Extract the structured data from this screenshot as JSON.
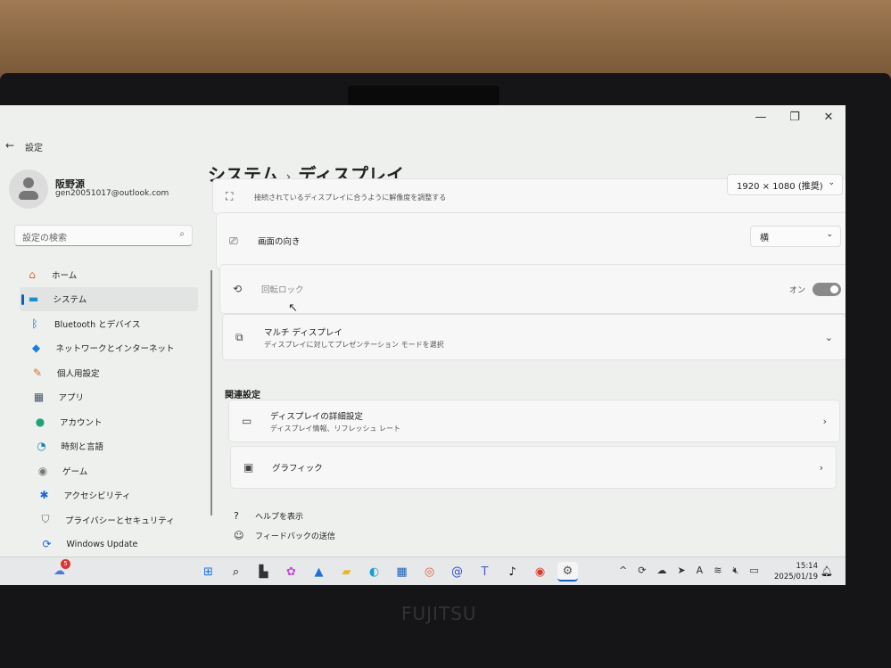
{
  "window": {
    "title": "設定",
    "controls": [
      "—",
      "❐",
      "✕"
    ]
  },
  "user": {
    "name": "阪野源",
    "email": "gen20051017@outlook.com"
  },
  "search": {
    "placeholder": "設定の検索"
  },
  "sidebar": {
    "items": [
      {
        "label": "ホーム",
        "icon": "home-icon",
        "glyph": "⌂",
        "color": "#d9663b"
      },
      {
        "label": "システム",
        "icon": "system-icon",
        "glyph": "▬",
        "color": "#1a8fd0",
        "selected": true
      },
      {
        "label": "Bluetooth とデバイス",
        "icon": "bluetooth-icon",
        "glyph": "ᛒ",
        "color": "#1565d8"
      },
      {
        "label": "ネットワークとインターネット",
        "icon": "wifi-icon",
        "glyph": "◆",
        "color": "#1a7fd8"
      },
      {
        "label": "個人用設定",
        "icon": "brush-icon",
        "glyph": "✎",
        "color": "#d0702a"
      },
      {
        "label": "アプリ",
        "icon": "apps-icon",
        "glyph": "▦",
        "color": "#445566"
      },
      {
        "label": "アカウント",
        "icon": "account-icon",
        "glyph": "●",
        "color": "#1fa37a"
      },
      {
        "label": "時刻と言語",
        "icon": "clock-globe-icon",
        "glyph": "◔",
        "color": "#1a7fb8"
      },
      {
        "label": "ゲーム",
        "icon": "gamepad-icon",
        "glyph": "◉",
        "color": "#777"
      },
      {
        "label": "アクセシビリティ",
        "icon": "accessibility-icon",
        "glyph": "✱",
        "color": "#1565d8"
      },
      {
        "label": "プライバシーとセキュリティ",
        "icon": "shield-icon",
        "glyph": "⛉",
        "color": "#666"
      },
      {
        "label": "Windows Update",
        "icon": "update-icon",
        "glyph": "⟳",
        "color": "#1565d8"
      }
    ]
  },
  "breadcrumb": {
    "parent": "システム",
    "current": "ディスプレイ"
  },
  "settings": {
    "resolution": {
      "subtitle": "接続されているディスプレイに合うように解像度を調整する",
      "value": "1920 × 1080 (推奨)"
    },
    "orientation": {
      "title": "画面の向き",
      "value": "横"
    },
    "rotation_lock": {
      "title": "回転ロック",
      "state": "オン",
      "enabled": true
    },
    "multi_display": {
      "title": "マルチ ディスプレイ",
      "subtitle": "ディスプレイに対してプレゼンテーション モードを選択"
    }
  },
  "related": {
    "heading": "関連設定",
    "items": [
      {
        "title": "ディスプレイの詳細設定",
        "subtitle": "ディスプレイ情報、リフレッシュ レート"
      },
      {
        "title": "グラフィック",
        "subtitle": ""
      }
    ]
  },
  "links": {
    "help": "ヘルプを表示",
    "feedback": "フィードバックの送信"
  },
  "taskbar": {
    "weather_badge": "5",
    "clock_time": "15:14",
    "clock_date": "2025/01/19"
  },
  "brand": "FUJITSU"
}
